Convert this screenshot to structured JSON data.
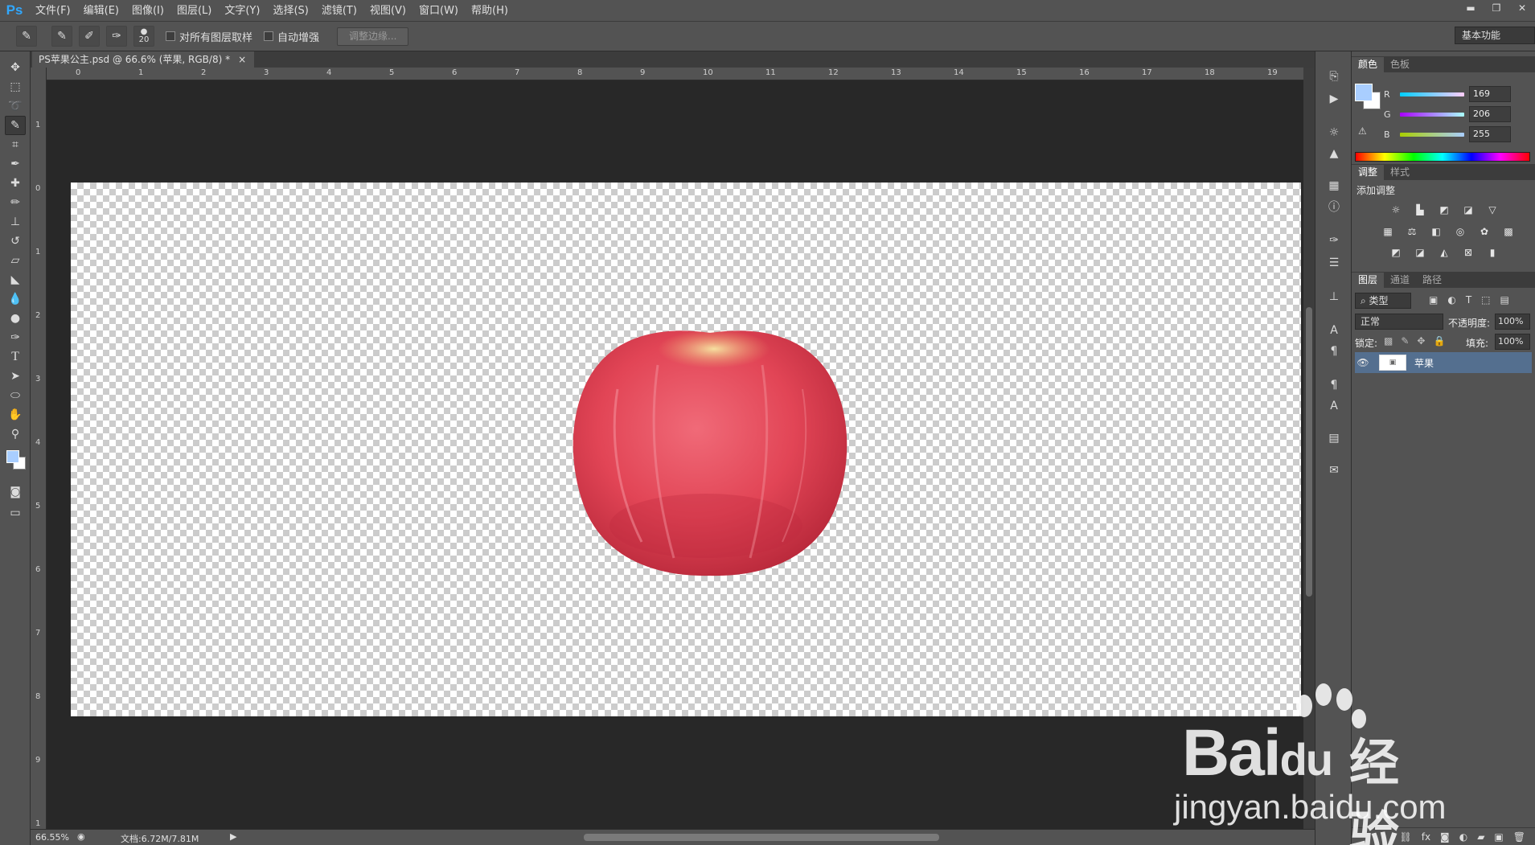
{
  "app": {
    "logo": "Ps",
    "title": "Photoshop"
  },
  "menu": [
    "文件(F)",
    "编辑(E)",
    "图像(I)",
    "图层(L)",
    "文字(Y)",
    "选择(S)",
    "滤镜(T)",
    "视图(V)",
    "窗口(W)",
    "帮助(H)"
  ],
  "window_controls": {
    "minimize": "▬",
    "restore": "❐",
    "close": "✕"
  },
  "options": {
    "brush_size": "20",
    "sample_all_layers": "对所有图层取样",
    "auto_enhance": "自动增强",
    "refine_edge": "调整边缘...",
    "workspace": "基本功能"
  },
  "document": {
    "tab_title": "PS苹果公主.psd @ 66.6% (苹果, RGB/8) *",
    "close": "×"
  },
  "ruler_top": [
    "0",
    "1",
    "2",
    "3",
    "4",
    "5",
    "6",
    "7",
    "8",
    "9",
    "10",
    "11",
    "12",
    "13",
    "14",
    "15",
    "16",
    "17",
    "18",
    "19"
  ],
  "ruler_left": [
    "1",
    "0",
    "1",
    "2",
    "3",
    "4",
    "5",
    "6",
    "7",
    "8",
    "9",
    "1"
  ],
  "status": {
    "zoom": "66.55%",
    "doc_info": "文档:6.72M/7.81M"
  },
  "color_panel": {
    "tabs": [
      "颜色",
      "色板"
    ],
    "r_label": "R",
    "g_label": "G",
    "b_label": "B",
    "r": "169",
    "g": "206",
    "b": "255",
    "foreground": "#a9ceff"
  },
  "adjust_panel": {
    "tabs": [
      "调整",
      "样式"
    ],
    "heading": "添加调整"
  },
  "layers_panel": {
    "tabs": [
      "图层",
      "通道",
      "路径"
    ],
    "filter": "类型",
    "blend_mode": "正常",
    "opacity_label": "不透明度:",
    "opacity": "100%",
    "lock_label": "锁定:",
    "fill_label": "填充:",
    "fill": "100%",
    "layers": [
      {
        "name": "苹果",
        "visible": true,
        "selected": true
      }
    ]
  },
  "watermark": {
    "brand": "Bai",
    "brand_suffix": "du",
    "cn": "经验",
    "url": "jingyan.baidu.com"
  }
}
